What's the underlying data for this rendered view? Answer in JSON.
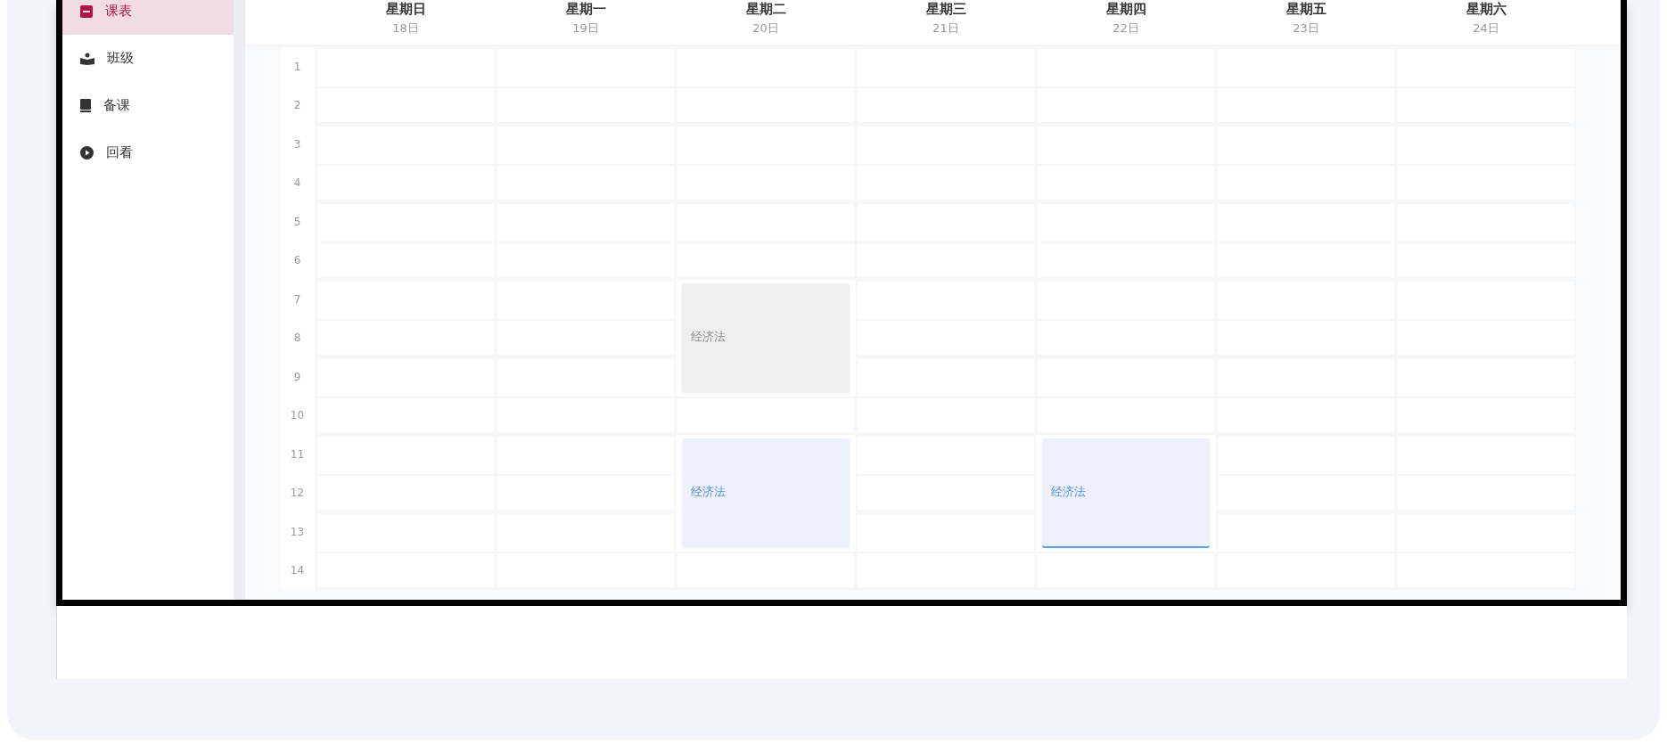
{
  "sidebar": {
    "items": [
      {
        "label": "课表",
        "selected": true
      },
      {
        "label": "班级",
        "selected": false
      },
      {
        "label": "备课",
        "selected": false
      },
      {
        "label": "回看",
        "selected": false
      }
    ]
  },
  "periods": [
    "1",
    "2",
    "3",
    "4",
    "5",
    "6",
    "7",
    "8",
    "9",
    "10",
    "11",
    "12",
    "13",
    "14"
  ],
  "days": [
    {
      "name": "星期日",
      "date": "18日",
      "slots": [
        {
          "kind": "free"
        },
        {
          "kind": "free"
        },
        {
          "kind": "free"
        },
        {
          "kind": "free"
        },
        {
          "kind": "free"
        },
        {
          "kind": "free"
        },
        {
          "kind": "free"
        },
        {
          "kind": "free"
        },
        {
          "kind": "free"
        },
        {
          "kind": "free"
        },
        {
          "kind": "free"
        },
        {
          "kind": "free"
        },
        {
          "kind": "free"
        },
        {
          "kind": "free"
        }
      ]
    },
    {
      "name": "星期一",
      "date": "19日",
      "slots": [
        {
          "kind": "free"
        },
        {
          "kind": "free"
        },
        {
          "kind": "free"
        },
        {
          "kind": "free"
        },
        {
          "kind": "free"
        },
        {
          "kind": "free"
        },
        {
          "kind": "free"
        },
        {
          "kind": "free"
        },
        {
          "kind": "free"
        },
        {
          "kind": "free"
        },
        {
          "kind": "free"
        },
        {
          "kind": "free"
        },
        {
          "kind": "free"
        },
        {
          "kind": "free"
        }
      ]
    },
    {
      "name": "星期二",
      "date": "20日",
      "slots": [
        {
          "kind": "free"
        },
        {
          "kind": "free"
        },
        {
          "kind": "free"
        },
        {
          "kind": "free"
        },
        {
          "kind": "free"
        },
        {
          "kind": "free"
        },
        {
          "kind": "finished",
          "title": "经济法",
          "selected": false
        },
        {
          "kind": "free"
        },
        {
          "kind": "scheduled",
          "title": "经济法",
          "selected": false
        },
        {
          "kind": "free"
        }
      ]
    },
    {
      "name": "星期三",
      "date": "21日",
      "slots": [
        {
          "kind": "free"
        },
        {
          "kind": "free"
        },
        {
          "kind": "free"
        },
        {
          "kind": "free"
        },
        {
          "kind": "free"
        },
        {
          "kind": "free"
        },
        {
          "kind": "free"
        },
        {
          "kind": "free"
        },
        {
          "kind": "free"
        },
        {
          "kind": "free"
        },
        {
          "kind": "free"
        },
        {
          "kind": "free"
        },
        {
          "kind": "free"
        },
        {
          "kind": "free"
        }
      ]
    },
    {
      "name": "星期四",
      "date": "22日",
      "slots": [
        {
          "kind": "free"
        },
        {
          "kind": "free"
        },
        {
          "kind": "free"
        },
        {
          "kind": "free"
        },
        {
          "kind": "free"
        },
        {
          "kind": "free"
        },
        {
          "kind": "free"
        },
        {
          "kind": "free"
        },
        {
          "kind": "free"
        },
        {
          "kind": "free"
        },
        {
          "kind": "scheduled",
          "title": "经济法",
          "selected": true
        },
        {
          "kind": "free"
        }
      ]
    },
    {
      "name": "星期五",
      "date": "23日",
      "slots": [
        {
          "kind": "free"
        },
        {
          "kind": "free"
        },
        {
          "kind": "free"
        },
        {
          "kind": "free"
        },
        {
          "kind": "free"
        },
        {
          "kind": "free"
        },
        {
          "kind": "free"
        },
        {
          "kind": "free"
        },
        {
          "kind": "free"
        },
        {
          "kind": "free"
        },
        {
          "kind": "free"
        },
        {
          "kind": "free"
        },
        {
          "kind": "free"
        },
        {
          "kind": "free"
        }
      ]
    },
    {
      "name": "星期六",
      "date": "24日",
      "slots": [
        {
          "kind": "free"
        },
        {
          "kind": "free"
        },
        {
          "kind": "free"
        },
        {
          "kind": "free"
        },
        {
          "kind": "free"
        },
        {
          "kind": "free"
        },
        {
          "kind": "free"
        },
        {
          "kind": "free"
        },
        {
          "kind": "free"
        },
        {
          "kind": "free"
        },
        {
          "kind": "free"
        },
        {
          "kind": "free"
        },
        {
          "kind": "free"
        },
        {
          "kind": "free"
        }
      ]
    }
  ]
}
